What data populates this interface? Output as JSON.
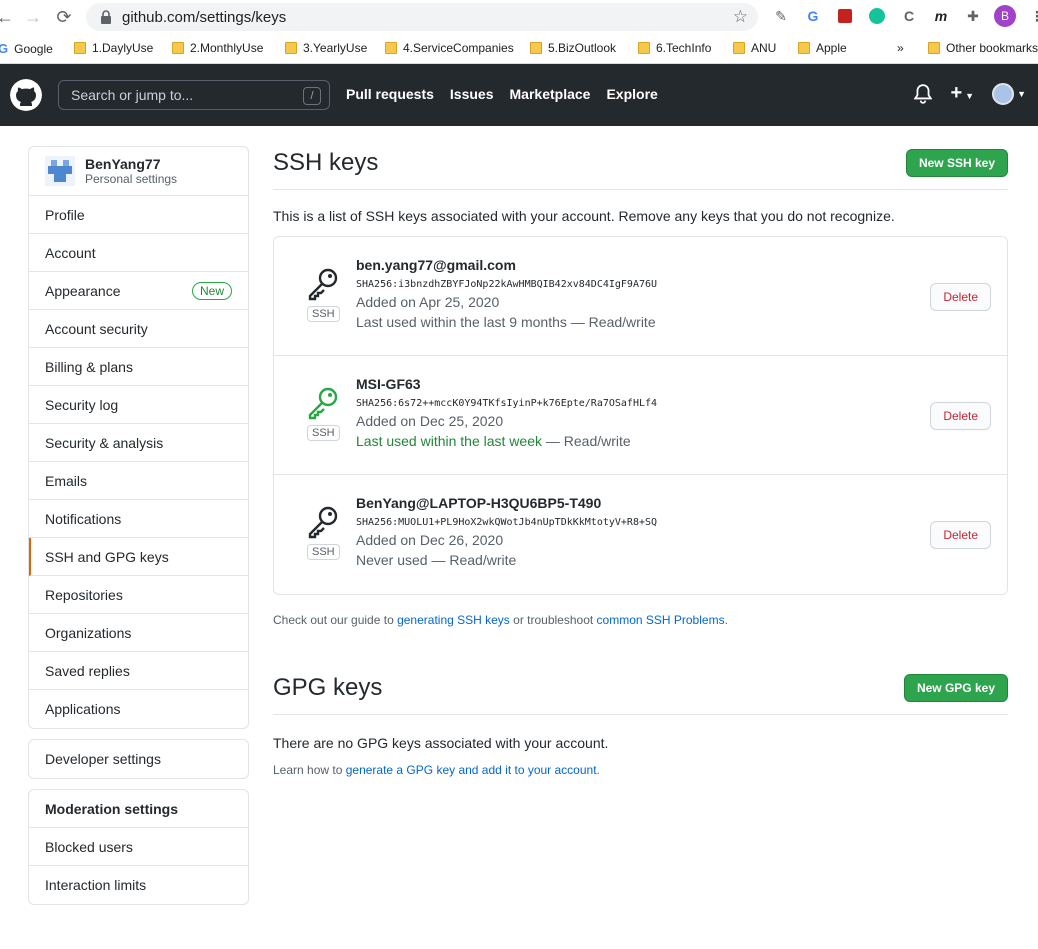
{
  "browser": {
    "url": "github.com/settings/keys",
    "bookmarks": [
      "Google",
      "1.DaylyUse",
      "2.MonthlyUse",
      "3.YearlyUse",
      "4.ServiceCompanies",
      "5.BizOutlook",
      "6.TechInfo",
      "ANU",
      "Apple"
    ],
    "overflow": "»",
    "other": "Other bookmarks",
    "profile_letter": "B"
  },
  "header": {
    "search_placeholder": "Search or jump to...",
    "search_key": "/",
    "nav": [
      "Pull requests",
      "Issues",
      "Marketplace",
      "Explore"
    ]
  },
  "sidebar": {
    "username": "BenYang77",
    "subtitle": "Personal settings",
    "items": [
      "Profile",
      "Account",
      "Appearance",
      "Account security",
      "Billing & plans",
      "Security log",
      "Security & analysis",
      "Emails",
      "Notifications",
      "SSH and GPG keys",
      "Repositories",
      "Organizations",
      "Saved replies",
      "Applications"
    ],
    "appearance_badge": "New",
    "developer": "Developer settings",
    "moderation_title": "Moderation settings",
    "moderation_items": [
      "Blocked users",
      "Interaction limits"
    ]
  },
  "ssh": {
    "title": "SSH keys",
    "new_button": "New SSH key",
    "description": "This is a list of SSH keys associated with your account. Remove any keys that you do not recognize.",
    "tag": "SSH",
    "delete_label": "Delete",
    "keys": [
      {
        "title": "ben.yang77@gmail.com",
        "fingerprint": "SHA256:i3bnzdhZBYFJoNp22kAwHMBQIB42xv84DC4IgF9A76U",
        "added": "Added on Apr 25, 2020",
        "used": "Last used within the last 9 months",
        "access": " — Read/write"
      },
      {
        "title": "MSI-GF63",
        "fingerprint": "SHA256:6s72++mccK0Y94TKfsIyinP+k76Epte/Ra7OSafHLf4",
        "added": "Added on Dec 25, 2020",
        "used": "Last used within the last week",
        "access": " — Read/write"
      },
      {
        "title": "BenYang@LAPTOP-H3QU6BP5-T490",
        "fingerprint": "SHA256:MUOLU1+PL9HoX2wkQWotJb4nUpTDkKkMtotyV+R8+SQ",
        "added": "Added on Dec 26, 2020",
        "used": "Never used",
        "access": " — Read/write"
      }
    ],
    "help_prefix": "Check out our guide to ",
    "help_link1": "generating SSH keys",
    "help_mid": " or troubleshoot ",
    "help_link2": "common SSH Problems",
    "help_suffix": "."
  },
  "gpg": {
    "title": "GPG keys",
    "new_button": "New GPG key",
    "none": "There are no GPG keys associated with your account.",
    "help_prefix": "Learn how to ",
    "help_link": "generate a GPG key and add it to your account",
    "help_suffix": "."
  },
  "colors": {
    "header_bg": "#24292e",
    "green": "#2ea44f",
    "link": "#0366d6",
    "danger": "#cb2431"
  }
}
